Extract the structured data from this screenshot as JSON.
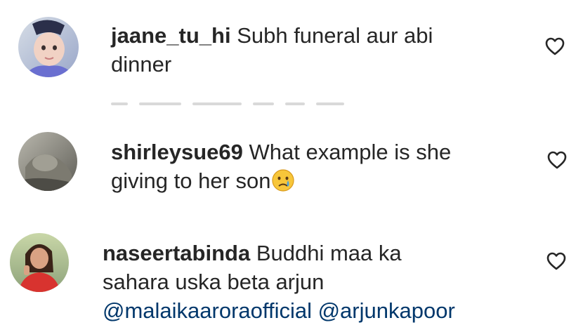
{
  "comments": [
    {
      "username": "jaane_tu_hi",
      "text_line1": "Subh funeral aur abi",
      "text_line2": "dinner",
      "avatar_icon": "avatar-child-photo",
      "like_icon": "heart-outline-icon"
    },
    {
      "username": "shirleysue69",
      "text_line1": "What example is she",
      "text_line2": "giving to her son",
      "emoji": "crying-face-emoji",
      "avatar_icon": "avatar-photo",
      "like_icon": "heart-outline-icon"
    },
    {
      "username": "naseertabinda",
      "text_line1": "Buddhi maa ka",
      "text_line2": "sahara uska beta arjun",
      "mentions": "@malaikaaroraofficial @arjunkapoor",
      "avatar_icon": "avatar-woman-photo",
      "like_icon": "heart-outline-icon"
    }
  ],
  "colors": {
    "text": "#262626",
    "mention": "#00376b",
    "background": "#ffffff"
  }
}
